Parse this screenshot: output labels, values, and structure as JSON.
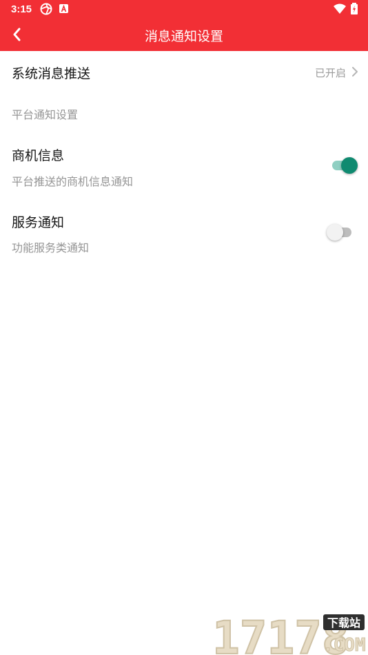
{
  "status_bar": {
    "time": "3:15"
  },
  "app_bar": {
    "title": "消息通知设置",
    "background": "#f22f35"
  },
  "settings": {
    "push": {
      "title": "系统消息推送",
      "status": "已开启"
    },
    "section_header": "平台通知设置",
    "business": {
      "title": "商机信息",
      "subtitle": "平台推送的商机信息通知",
      "enabled": true
    },
    "service": {
      "title": "服务通知",
      "subtitle": "功能服务类通知",
      "enabled": false
    }
  },
  "watermark": {
    "number": "17178",
    "label": "下载站",
    "suffix": ".COM"
  },
  "colors": {
    "toggle_on_thumb": "#0f8a70",
    "toggle_on_track": "#8fcfc2",
    "toggle_off_thumb": "#f2f2f2",
    "toggle_off_track": "#bdbdbd"
  }
}
